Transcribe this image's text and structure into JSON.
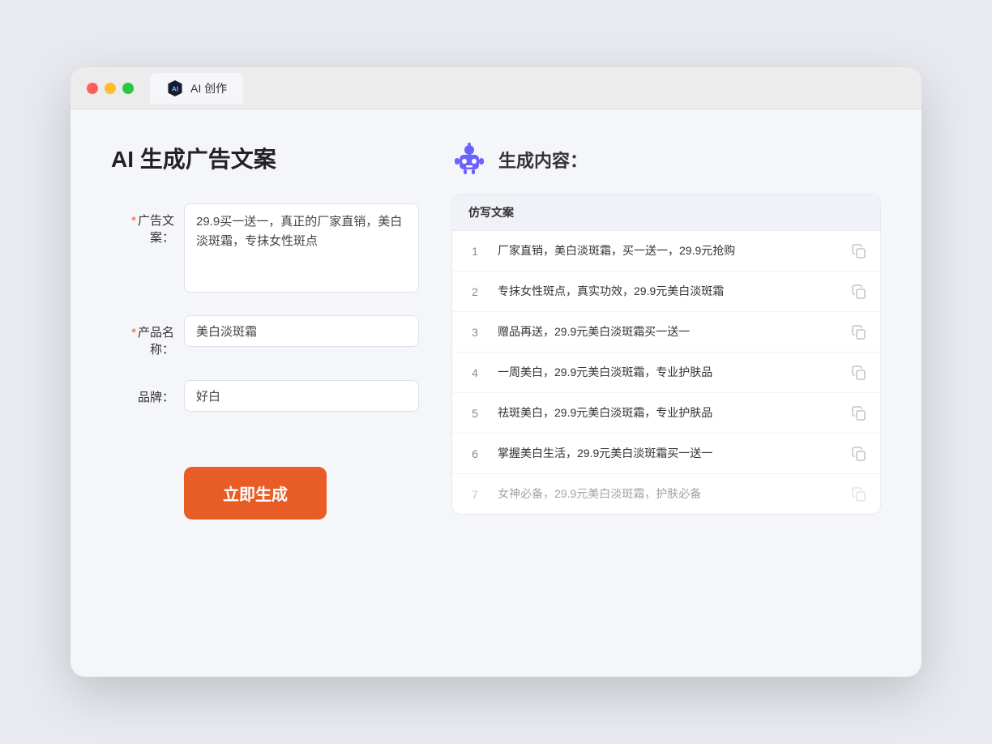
{
  "browser": {
    "tab_label": "AI 创作"
  },
  "page": {
    "title": "AI 生成广告文案",
    "result_header": "生成内容："
  },
  "form": {
    "ad_copy_label": "广告文案：",
    "ad_copy_required": true,
    "ad_copy_value": "29.9买一送一，真正的厂家直销，美白淡斑霜，专抹女性斑点",
    "product_name_label": "产品名称：",
    "product_name_required": true,
    "product_name_value": "美白淡斑霜",
    "brand_label": "品牌：",
    "brand_required": false,
    "brand_value": "好白",
    "generate_button": "立即生成"
  },
  "results": {
    "column_header": "仿写文案",
    "items": [
      {
        "num": "1",
        "text": "厂家直销，美白淡斑霜，买一送一，29.9元抢购",
        "dimmed": false
      },
      {
        "num": "2",
        "text": "专抹女性斑点，真实功效，29.9元美白淡斑霜",
        "dimmed": false
      },
      {
        "num": "3",
        "text": "赠品再送，29.9元美白淡斑霜买一送一",
        "dimmed": false
      },
      {
        "num": "4",
        "text": "一周美白，29.9元美白淡斑霜，专业护肤品",
        "dimmed": false
      },
      {
        "num": "5",
        "text": "祛斑美白，29.9元美白淡斑霜，专业护肤品",
        "dimmed": false
      },
      {
        "num": "6",
        "text": "掌握美白生活，29.9元美白淡斑霜买一送一",
        "dimmed": false
      },
      {
        "num": "7",
        "text": "女神必备，29.9元美白淡斑霜，护肤必备",
        "dimmed": true
      }
    ]
  },
  "icons": {
    "red_dot": "●",
    "yellow_dot": "●",
    "green_dot": "●",
    "copy": "⧉"
  }
}
